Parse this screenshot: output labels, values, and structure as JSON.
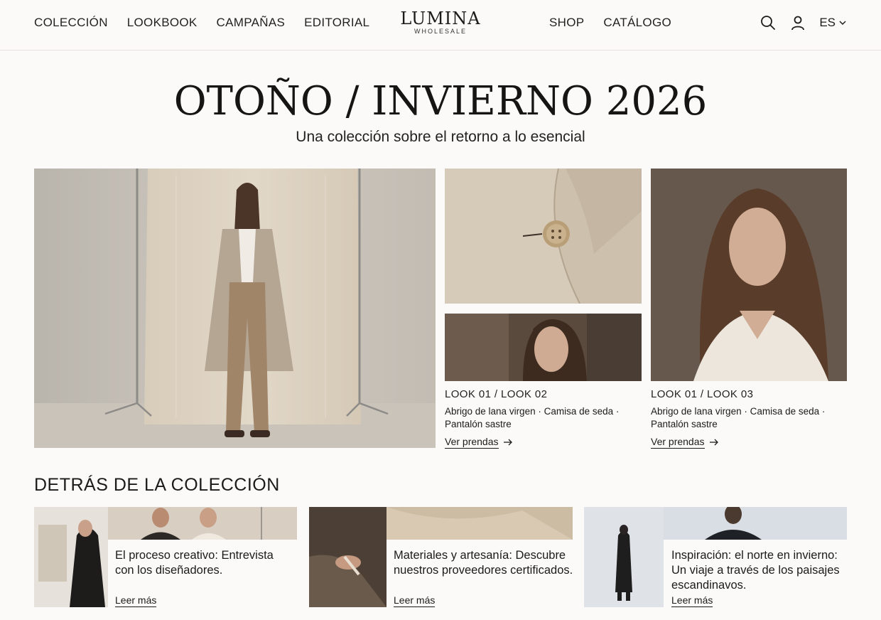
{
  "header": {
    "nav_left": [
      "COLECCIÓN",
      "LOOKBOOK",
      "CAMPAÑAS",
      "EDITORIAL"
    ],
    "logo_main": "LUMINA",
    "logo_sub": "WHOLESALE",
    "nav_center": [
      "SHOP",
      "CATÁLOGO"
    ],
    "language": "ES",
    "icons": [
      "search-icon",
      "user-icon",
      "chevron-down-icon"
    ]
  },
  "hero": {
    "title": "OTOÑO / INVIERNO 2026",
    "subtitle": "Una colección sobre el retorno a lo esencial"
  },
  "looks": [
    {
      "label": "LOOK 01 / LOOK 02",
      "desc": "Abrigo de lana virgen · Camisa de seda · Pantalón sastre",
      "link": "Ver prendas"
    },
    {
      "label": "LOOK 01 / LOOK 03",
      "desc": "Abrigo de lana virgen · Camisa de seda · Pantalón sastre",
      "link": "Ver prendas"
    }
  ],
  "behind": {
    "title": "DETRÁS DE LA COLECCIÓN",
    "cards": [
      {
        "text": "El proceso creativo: Entrevista con los diseñadores.",
        "link": "Leer más"
      },
      {
        "text": "Materiales y artesanía: Descubre nuestros proveedores certificados.",
        "link": "Leer más"
      },
      {
        "text": "Inspiración: el norte en invierno: Un viaje a través de los paisajes escandinavos.",
        "link": "Leer más"
      }
    ]
  },
  "colors": {
    "background": "#fbfaf8",
    "text": "#1c1b1a",
    "sand": "#d8cbb8",
    "coat": "#b5a593"
  }
}
